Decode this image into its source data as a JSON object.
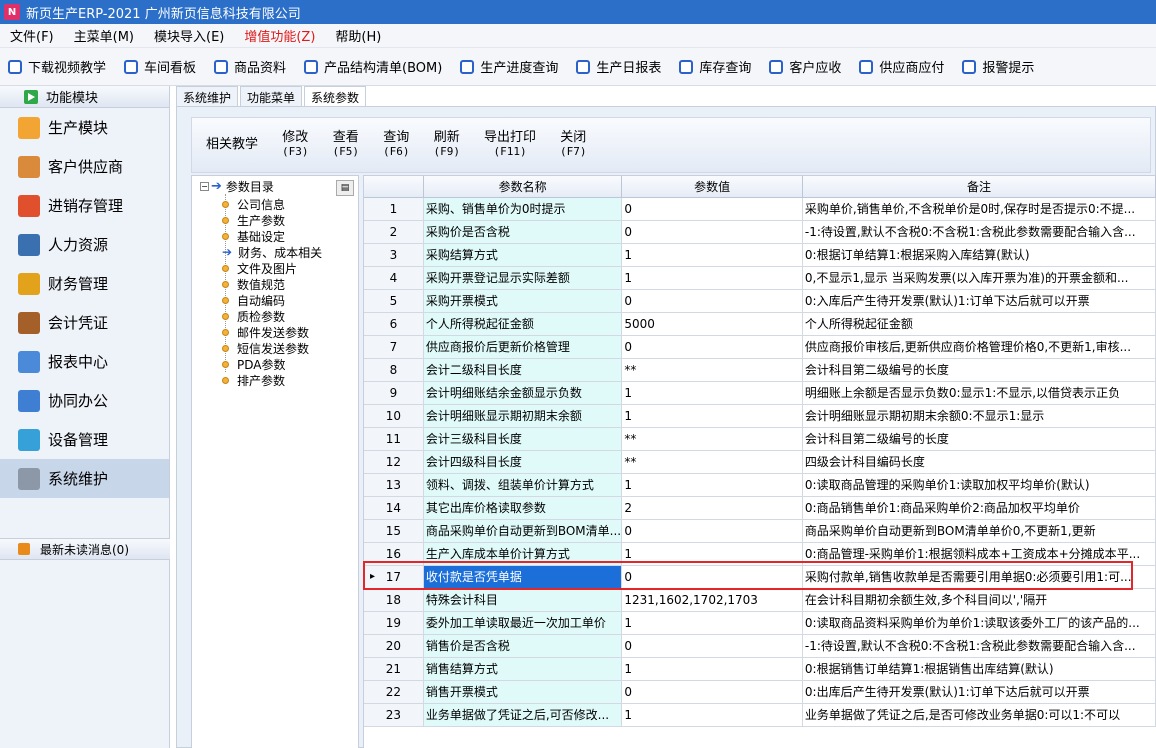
{
  "window": {
    "title": "新页生产ERP-2021 广州新页信息科技有限公司",
    "icon": "app-logo-icon"
  },
  "menu": [
    {
      "label": "文件(F)"
    },
    {
      "label": "主菜单(M)"
    },
    {
      "label": "模块导入(E)"
    },
    {
      "label": "增值功能(Z)",
      "highlight": true
    },
    {
      "label": "帮助(H)"
    }
  ],
  "toolbar": [
    "下载视频教学",
    "车间看板",
    "商品资料",
    "产品结构清单(BOM)",
    "生产进度查询",
    "生产日报表",
    "库存查询",
    "客户应收",
    "供应商应付",
    "报警提示"
  ],
  "sidebar": {
    "header": "功能模块",
    "items": [
      {
        "label": "生产模块",
        "icon": "folder-icon",
        "color": "#f3a534"
      },
      {
        "label": "客户供应商",
        "icon": "users-icon",
        "color": "#d98a3a"
      },
      {
        "label": "进销存管理",
        "icon": "bar-chart-icon",
        "color": "#e0502c"
      },
      {
        "label": "人力资源",
        "icon": "person-icon",
        "color": "#3a6fb0"
      },
      {
        "label": "财务管理",
        "icon": "coins-icon",
        "color": "#e3a21c"
      },
      {
        "label": "会计凭证",
        "icon": "notebook-icon",
        "color": "#a5602a"
      },
      {
        "label": "报表中心",
        "icon": "report-icon",
        "color": "#4a8ad9"
      },
      {
        "label": "协同办公",
        "icon": "calendar-icon",
        "color": "#3e7fd4"
      },
      {
        "label": "设备管理",
        "icon": "device-icon",
        "color": "#36a0d8"
      },
      {
        "label": "系统维护",
        "icon": "lock-icon",
        "color": "#8c98a8",
        "active": true
      }
    ],
    "messages": "最新未读消息(0)"
  },
  "tabs": [
    {
      "label": "系统维护"
    },
    {
      "label": "功能菜单"
    },
    {
      "label": "系统参数",
      "active": true
    }
  ],
  "actions": [
    {
      "label": "相关教学",
      "key": ""
    },
    {
      "label": "修改",
      "key": "(F3)"
    },
    {
      "label": "查看",
      "key": "(F5)"
    },
    {
      "label": "查询",
      "key": "(F6)"
    },
    {
      "label": "刷新",
      "key": "(F9)"
    },
    {
      "label": "导出打印",
      "key": "(F11)"
    },
    {
      "label": "关闭",
      "key": "(F7)"
    }
  ],
  "tree": {
    "root": "参数目录",
    "nodes": [
      "公司信息",
      "生产参数",
      "基础设定",
      "财务、成本相关",
      "文件及图片",
      "数值规范",
      "自动编码",
      "质检参数",
      "邮件发送参数",
      "短信发送参数",
      "PDA参数",
      "排产参数"
    ],
    "selected_index": 3
  },
  "grid": {
    "columns": [
      "",
      "参数名称",
      "参数值",
      "备注"
    ],
    "selected_row": 16,
    "rows": [
      [
        "1",
        "采购、销售单价为0时提示",
        "0",
        "采购单价,销售单价,不含税单价是0时,保存时是否提示0:不提..."
      ],
      [
        "2",
        "采购价是否含税",
        "0",
        "-1:待设置,默认不含税0:不含税1:含税此参数需要配合输入含..."
      ],
      [
        "3",
        "采购结算方式",
        "1",
        "0:根据订单结算1:根据采购入库结算(默认)"
      ],
      [
        "4",
        "采购开票登记显示实际差额",
        "1",
        "0,不显示1,显示 当采购发票(以入库开票为准)的开票金额和..."
      ],
      [
        "5",
        "采购开票模式",
        "0",
        "0:入库后产生待开发票(默认)1:订单下达后就可以开票"
      ],
      [
        "6",
        "个人所得税起征金额",
        "5000",
        "个人所得税起征金额"
      ],
      [
        "7",
        "供应商报价后更新价格管理",
        "0",
        "供应商报价审核后,更新供应商价格管理价格0,不更新1,审核..."
      ],
      [
        "8",
        "会计二级科目长度",
        "**",
        "会计科目第二级编号的长度"
      ],
      [
        "9",
        "会计明细账结余金额显示负数",
        "1",
        "明细账上余额是否显示负数0:显示1:不显示,以借贷表示正负"
      ],
      [
        "10",
        "会计明细账显示期初期末余额",
        "1",
        "会计明细账显示期初期末余额0:不显示1:显示"
      ],
      [
        "11",
        "会计三级科目长度",
        "**",
        "会计科目第二级编号的长度"
      ],
      [
        "12",
        "会计四级科目长度",
        "**",
        "四级会计科目编码长度"
      ],
      [
        "13",
        "领料、调拨、组装单价计算方式",
        "1",
        "0:读取商品管理的采购单价1:读取加权平均单价(默认)"
      ],
      [
        "14",
        "其它出库价格读取参数",
        "2",
        "0:商品销售单价1:商品采购单价2:商品加权平均单价"
      ],
      [
        "15",
        "商品采购单价自动更新到BOM清单...",
        "0",
        "商品采购单价自动更新到BOM清单单价0,不更新1,更新"
      ],
      [
        "16",
        "生产入库成本单价计算方式",
        "1",
        "0:商品管理-采购单价1:根据领料成本+工资成本+分摊成本平..."
      ],
      [
        "17",
        "收付款是否凭单据",
        "0",
        "采购付款单,销售收款单是否需要引用单据0:必须要引用1:可..."
      ],
      [
        "18",
        "特殊会计科目",
        "1231,1602,1702,1703",
        "在会计科目期初余额生效,多个科目间以','隔开"
      ],
      [
        "19",
        "委外加工单读取最近一次加工单价",
        "1",
        "0:读取商品资料采购单价为单价1:读取该委外工厂的该产品的..."
      ],
      [
        "20",
        "销售价是否含税",
        "0",
        "-1:待设置,默认不含税0:不含税1:含税此参数需要配合输入含..."
      ],
      [
        "21",
        "销售结算方式",
        "1",
        "0:根据销售订单结算1:根据销售出库结算(默认)"
      ],
      [
        "22",
        "销售开票模式",
        "0",
        "0:出库后产生待开发票(默认)1:订单下达后就可以开票"
      ],
      [
        "23",
        "业务单据做了凭证之后,可否修改...",
        "1",
        "业务单据做了凭证之后,是否可修改业务单据0:可以1:不可以"
      ]
    ]
  }
}
